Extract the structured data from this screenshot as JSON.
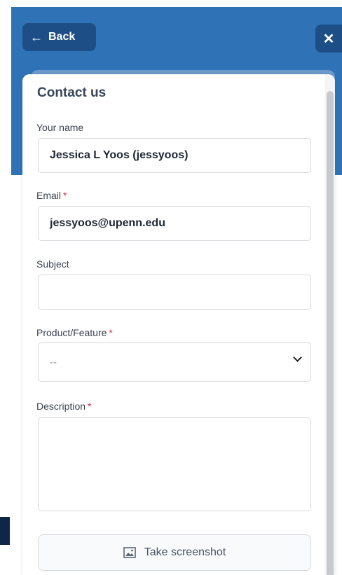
{
  "header": {
    "back_label": "Back",
    "back_icon": "arrow-left-icon",
    "close_icon": "close-icon",
    "close_glyph": "✕"
  },
  "form": {
    "title": "Contact us",
    "name": {
      "label": "Your name",
      "value": "Jessica L Yoos (jessyoos)"
    },
    "email": {
      "label": "Email",
      "required_mark": "*",
      "value": "jessyoos@upenn.edu"
    },
    "subject": {
      "label": "Subject",
      "value": ""
    },
    "product": {
      "label": "Product/Feature",
      "required_mark": "*",
      "selected": "--"
    },
    "description": {
      "label": "Description",
      "required_mark": "*",
      "value": ""
    },
    "screenshot_button": {
      "label": "Take screenshot",
      "icon": "image-icon"
    }
  },
  "colors": {
    "header_blue": "#2f73b6",
    "button_blue": "#1d4f86",
    "required_red": "#d6303b"
  }
}
